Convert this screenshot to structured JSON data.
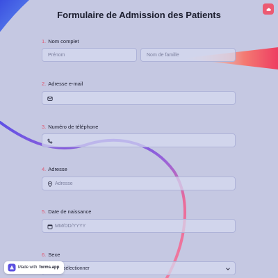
{
  "form": {
    "title": "Formulaire de Admission des Patients"
  },
  "fields": {
    "name": {
      "number": "1.",
      "label": "Nom complet",
      "first_placeholder": "Prénom",
      "last_placeholder": "Nom de famille"
    },
    "email": {
      "number": "2.",
      "label": "Adresse e-mail",
      "value": ""
    },
    "phone": {
      "number": "3.",
      "label": "Numéro de téléphone",
      "value": ""
    },
    "address": {
      "number": "4.",
      "label": "Adresse",
      "placeholder": "Adresse"
    },
    "birthdate": {
      "number": "5.",
      "label": "Date de naissance",
      "placeholder": "MM/DD/YYYY"
    },
    "sex": {
      "number": "6.",
      "label": "Sexe",
      "selected": "sélectionner"
    }
  },
  "badge": {
    "prefix": "Made with",
    "brand": "forms.app"
  },
  "colors": {
    "background": "#c5c8e2",
    "accent": "#e0566e",
    "field_border": "#aeb3d8"
  }
}
